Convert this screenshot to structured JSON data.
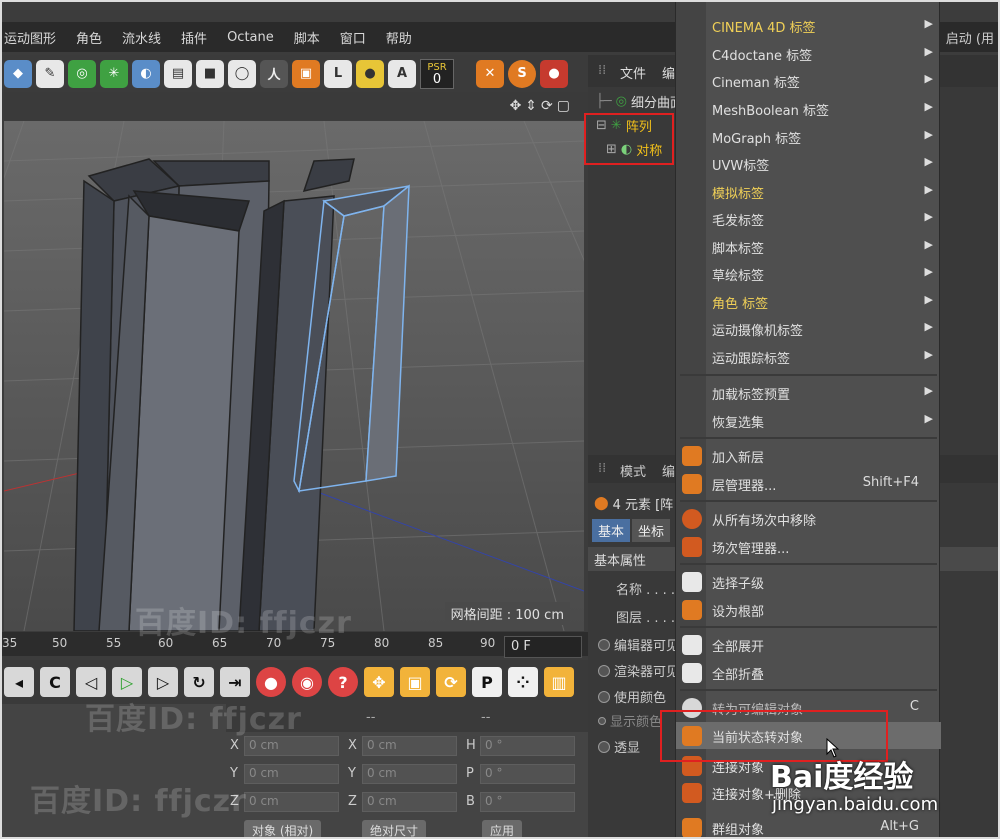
{
  "menubar": {
    "items": [
      "运动图形",
      "角色",
      "流水线",
      "插件",
      "Octane",
      "脚本",
      "窗口",
      "帮助"
    ],
    "startup": "启动 (用"
  },
  "toolbar": {
    "psr_label": "PSR",
    "psr_value": "0"
  },
  "viewport": {
    "grid_spacing": "网格间距 : 100 cm"
  },
  "timeline": {
    "ticks": [
      "35",
      "50",
      "55",
      "60",
      "65",
      "70",
      "75",
      "80",
      "85",
      "90"
    ],
    "current_frame": "0 F"
  },
  "coordinates": {
    "header": [
      "--",
      "--"
    ],
    "rows": [
      {
        "l1": "X",
        "v1": "0 cm",
        "l2": "X",
        "v2": "0 cm",
        "l3": "H",
        "v3": "0 °"
      },
      {
        "l1": "Y",
        "v1": "0 cm",
        "l2": "Y",
        "v2": "0 cm",
        "l3": "P",
        "v3": "0 °"
      },
      {
        "l1": "Z",
        "v1": "0 cm",
        "l2": "Z",
        "v2": "0 cm",
        "l3": "B",
        "v3": "0 °"
      }
    ],
    "buttons": [
      "对象 (相对)",
      "绝对尺寸",
      "应用"
    ]
  },
  "object_manager": {
    "header": [
      "文件",
      "编"
    ],
    "items": [
      {
        "label": "细分曲面",
        "selected": false
      },
      {
        "label": "阵列",
        "selected": true
      },
      {
        "label": "对称",
        "selected": true
      }
    ]
  },
  "attributes": {
    "header": [
      "模式",
      "编"
    ],
    "count": "4 元素 [阵",
    "tabs": [
      "基本",
      "坐标"
    ],
    "section": "基本属性",
    "fields": [
      "名称 . . . .",
      "图层 . . . .",
      "编辑器可见",
      "渲染器可见",
      "使用颜色",
      "显示颜色",
      "透显"
    ]
  },
  "context_menu": {
    "items": [
      {
        "label": "CINEMA 4D 标签",
        "type": "submenu",
        "gold": true
      },
      {
        "label": "C4doctane 标签",
        "type": "submenu"
      },
      {
        "label": "Cineman 标签",
        "type": "submenu"
      },
      {
        "label": "MeshBoolean 标签",
        "type": "submenu"
      },
      {
        "label": "MoGraph 标签",
        "type": "submenu"
      },
      {
        "label": "UVW标签",
        "type": "submenu"
      },
      {
        "label": "模拟标签",
        "type": "submenu",
        "gold": true
      },
      {
        "label": "毛发标签",
        "type": "submenu"
      },
      {
        "label": "脚本标签",
        "type": "submenu"
      },
      {
        "label": "草绘标签",
        "type": "submenu"
      },
      {
        "label": "角色 标签",
        "type": "submenu",
        "gold": true
      },
      {
        "label": "运动摄像机标签",
        "type": "submenu"
      },
      {
        "label": "运动跟踪标签",
        "type": "submenu"
      },
      {
        "label": "加载标签预置",
        "type": "submenu"
      },
      {
        "label": "恢复选集",
        "type": "submenu"
      },
      {
        "label": "加入新层",
        "type": "action",
        "icon": "layer-add-icon"
      },
      {
        "label": "层管理器...",
        "type": "action",
        "shortcut": "Shift+F4",
        "icon": "layer-manager-icon"
      },
      {
        "label": "从所有场次中移除",
        "type": "action",
        "icon": "take-remove-icon"
      },
      {
        "label": "场次管理器...",
        "type": "action",
        "icon": "take-manager-icon"
      },
      {
        "label": "选择子级",
        "type": "action",
        "icon": "select-children-icon"
      },
      {
        "label": "设为根部",
        "type": "action",
        "icon": "set-root-icon"
      },
      {
        "label": "全部展开",
        "type": "action",
        "icon": "expand-all-icon"
      },
      {
        "label": "全部折叠",
        "type": "action",
        "icon": "collapse-all-icon"
      },
      {
        "label": "转为可编辑对象",
        "type": "action",
        "shortcut": "C",
        "icon": "make-editable-icon"
      },
      {
        "label": "当前状态转对象",
        "type": "action",
        "highlighted": true,
        "icon": "current-state-icon"
      },
      {
        "label": "连接对象",
        "type": "action",
        "icon": "connect-objects-icon"
      },
      {
        "label": "连接对象+删除",
        "type": "action",
        "icon": "connect-delete-icon"
      },
      {
        "label": "群组对象",
        "type": "action",
        "shortcut": "Alt+G",
        "icon": "group-objects-icon"
      }
    ]
  },
  "watermark": {
    "text": "百度ID: ffjczr",
    "brand": "Bai度经验",
    "url": "jingyan.baidu.com"
  },
  "colors": {
    "highlight_box": "#e02020",
    "selected_text": "#f3c11a",
    "gold_label": "#f0d057"
  }
}
